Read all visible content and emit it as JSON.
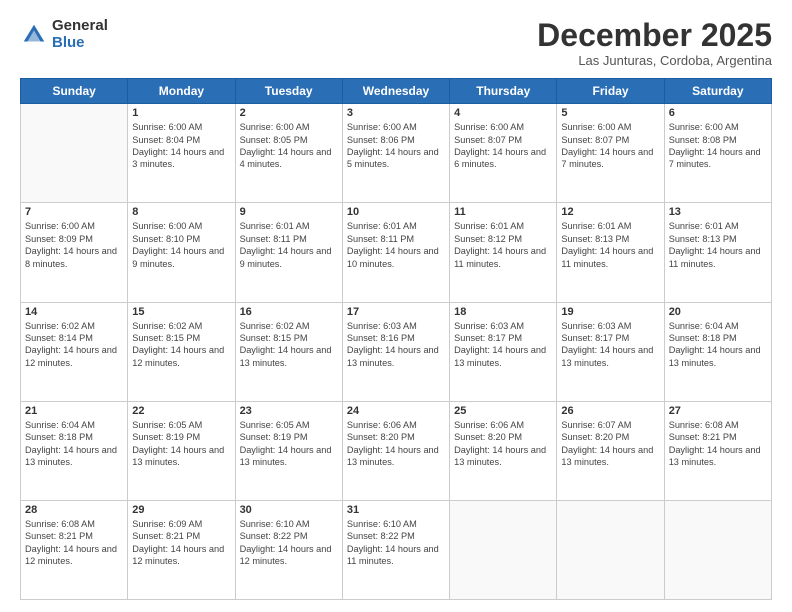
{
  "logo": {
    "general": "General",
    "blue": "Blue"
  },
  "header": {
    "month": "December 2025",
    "location": "Las Junturas, Cordoba, Argentina"
  },
  "days_of_week": [
    "Sunday",
    "Monday",
    "Tuesday",
    "Wednesday",
    "Thursday",
    "Friday",
    "Saturday"
  ],
  "weeks": [
    [
      {
        "day": "",
        "empty": true
      },
      {
        "day": "1",
        "sunrise": "Sunrise: 6:00 AM",
        "sunset": "Sunset: 8:04 PM",
        "daylight": "Daylight: 14 hours and 3 minutes."
      },
      {
        "day": "2",
        "sunrise": "Sunrise: 6:00 AM",
        "sunset": "Sunset: 8:05 PM",
        "daylight": "Daylight: 14 hours and 4 minutes."
      },
      {
        "day": "3",
        "sunrise": "Sunrise: 6:00 AM",
        "sunset": "Sunset: 8:06 PM",
        "daylight": "Daylight: 14 hours and 5 minutes."
      },
      {
        "day": "4",
        "sunrise": "Sunrise: 6:00 AM",
        "sunset": "Sunset: 8:07 PM",
        "daylight": "Daylight: 14 hours and 6 minutes."
      },
      {
        "day": "5",
        "sunrise": "Sunrise: 6:00 AM",
        "sunset": "Sunset: 8:07 PM",
        "daylight": "Daylight: 14 hours and 7 minutes."
      },
      {
        "day": "6",
        "sunrise": "Sunrise: 6:00 AM",
        "sunset": "Sunset: 8:08 PM",
        "daylight": "Daylight: 14 hours and 7 minutes."
      }
    ],
    [
      {
        "day": "7",
        "sunrise": "Sunrise: 6:00 AM",
        "sunset": "Sunset: 8:09 PM",
        "daylight": "Daylight: 14 hours and 8 minutes."
      },
      {
        "day": "8",
        "sunrise": "Sunrise: 6:00 AM",
        "sunset": "Sunset: 8:10 PM",
        "daylight": "Daylight: 14 hours and 9 minutes."
      },
      {
        "day": "9",
        "sunrise": "Sunrise: 6:01 AM",
        "sunset": "Sunset: 8:11 PM",
        "daylight": "Daylight: 14 hours and 9 minutes."
      },
      {
        "day": "10",
        "sunrise": "Sunrise: 6:01 AM",
        "sunset": "Sunset: 8:11 PM",
        "daylight": "Daylight: 14 hours and 10 minutes."
      },
      {
        "day": "11",
        "sunrise": "Sunrise: 6:01 AM",
        "sunset": "Sunset: 8:12 PM",
        "daylight": "Daylight: 14 hours and 11 minutes."
      },
      {
        "day": "12",
        "sunrise": "Sunrise: 6:01 AM",
        "sunset": "Sunset: 8:13 PM",
        "daylight": "Daylight: 14 hours and 11 minutes."
      },
      {
        "day": "13",
        "sunrise": "Sunrise: 6:01 AM",
        "sunset": "Sunset: 8:13 PM",
        "daylight": "Daylight: 14 hours and 11 minutes."
      }
    ],
    [
      {
        "day": "14",
        "sunrise": "Sunrise: 6:02 AM",
        "sunset": "Sunset: 8:14 PM",
        "daylight": "Daylight: 14 hours and 12 minutes."
      },
      {
        "day": "15",
        "sunrise": "Sunrise: 6:02 AM",
        "sunset": "Sunset: 8:15 PM",
        "daylight": "Daylight: 14 hours and 12 minutes."
      },
      {
        "day": "16",
        "sunrise": "Sunrise: 6:02 AM",
        "sunset": "Sunset: 8:15 PM",
        "daylight": "Daylight: 14 hours and 13 minutes."
      },
      {
        "day": "17",
        "sunrise": "Sunrise: 6:03 AM",
        "sunset": "Sunset: 8:16 PM",
        "daylight": "Daylight: 14 hours and 13 minutes."
      },
      {
        "day": "18",
        "sunrise": "Sunrise: 6:03 AM",
        "sunset": "Sunset: 8:17 PM",
        "daylight": "Daylight: 14 hours and 13 minutes."
      },
      {
        "day": "19",
        "sunrise": "Sunrise: 6:03 AM",
        "sunset": "Sunset: 8:17 PM",
        "daylight": "Daylight: 14 hours and 13 minutes."
      },
      {
        "day": "20",
        "sunrise": "Sunrise: 6:04 AM",
        "sunset": "Sunset: 8:18 PM",
        "daylight": "Daylight: 14 hours and 13 minutes."
      }
    ],
    [
      {
        "day": "21",
        "sunrise": "Sunrise: 6:04 AM",
        "sunset": "Sunset: 8:18 PM",
        "daylight": "Daylight: 14 hours and 13 minutes."
      },
      {
        "day": "22",
        "sunrise": "Sunrise: 6:05 AM",
        "sunset": "Sunset: 8:19 PM",
        "daylight": "Daylight: 14 hours and 13 minutes."
      },
      {
        "day": "23",
        "sunrise": "Sunrise: 6:05 AM",
        "sunset": "Sunset: 8:19 PM",
        "daylight": "Daylight: 14 hours and 13 minutes."
      },
      {
        "day": "24",
        "sunrise": "Sunrise: 6:06 AM",
        "sunset": "Sunset: 8:20 PM",
        "daylight": "Daylight: 14 hours and 13 minutes."
      },
      {
        "day": "25",
        "sunrise": "Sunrise: 6:06 AM",
        "sunset": "Sunset: 8:20 PM",
        "daylight": "Daylight: 14 hours and 13 minutes."
      },
      {
        "day": "26",
        "sunrise": "Sunrise: 6:07 AM",
        "sunset": "Sunset: 8:20 PM",
        "daylight": "Daylight: 14 hours and 13 minutes."
      },
      {
        "day": "27",
        "sunrise": "Sunrise: 6:08 AM",
        "sunset": "Sunset: 8:21 PM",
        "daylight": "Daylight: 14 hours and 13 minutes."
      }
    ],
    [
      {
        "day": "28",
        "sunrise": "Sunrise: 6:08 AM",
        "sunset": "Sunset: 8:21 PM",
        "daylight": "Daylight: 14 hours and 12 minutes."
      },
      {
        "day": "29",
        "sunrise": "Sunrise: 6:09 AM",
        "sunset": "Sunset: 8:21 PM",
        "daylight": "Daylight: 14 hours and 12 minutes."
      },
      {
        "day": "30",
        "sunrise": "Sunrise: 6:10 AM",
        "sunset": "Sunset: 8:22 PM",
        "daylight": "Daylight: 14 hours and 12 minutes."
      },
      {
        "day": "31",
        "sunrise": "Sunrise: 6:10 AM",
        "sunset": "Sunset: 8:22 PM",
        "daylight": "Daylight: 14 hours and 11 minutes."
      },
      {
        "day": "",
        "empty": true
      },
      {
        "day": "",
        "empty": true
      },
      {
        "day": "",
        "empty": true
      }
    ]
  ]
}
